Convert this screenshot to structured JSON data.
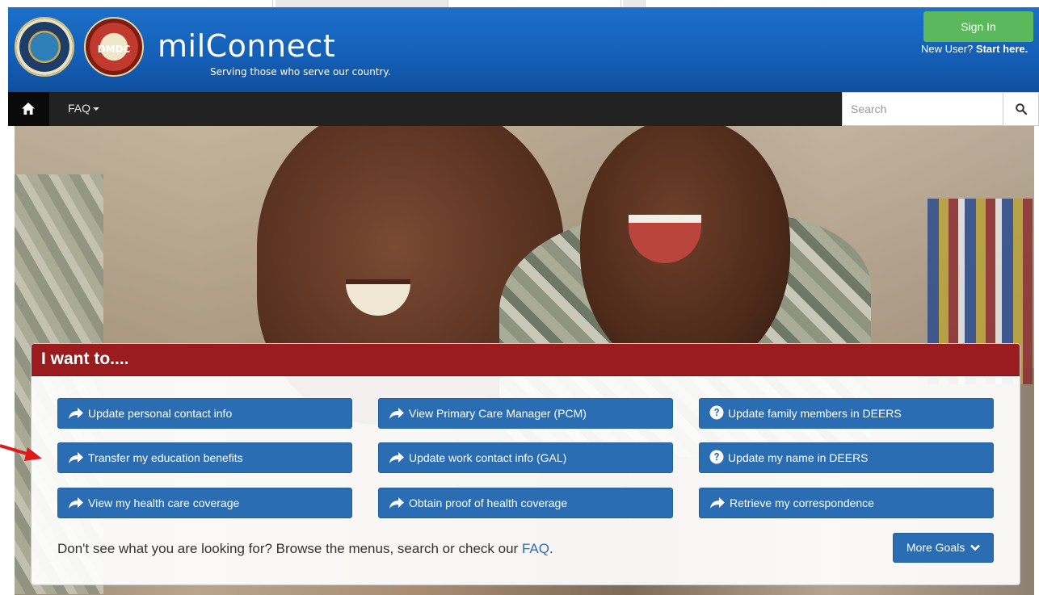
{
  "header": {
    "brand": "milConnect",
    "tagline": "Serving those who serve our country.",
    "dmdc_label": "DMDC",
    "sign_in": "Sign In",
    "new_user_prefix": "New User? ",
    "new_user_link": "Start here."
  },
  "nav": {
    "faq_label": "FAQ",
    "search_placeholder": "Search"
  },
  "goals": {
    "title": "I want to....",
    "items": [
      {
        "label": "Update personal contact info",
        "icon": "arrow-icon"
      },
      {
        "label": "View Primary Care Manager (PCM)",
        "icon": "arrow-icon"
      },
      {
        "label": "Update family members in DEERS",
        "icon": "question-circle-icon"
      },
      {
        "label": "Transfer my education benefits",
        "icon": "arrow-icon"
      },
      {
        "label": "Update work contact info (GAL)",
        "icon": "arrow-icon"
      },
      {
        "label": "Update my name in DEERS",
        "icon": "question-circle-icon"
      },
      {
        "label": "View my health care coverage",
        "icon": "arrow-icon"
      },
      {
        "label": "Obtain proof of health coverage",
        "icon": "arrow-icon"
      },
      {
        "label": "Retrieve my correspondence",
        "icon": "arrow-icon"
      }
    ],
    "browse_text": "Don't see what you are looking for? Browse the menus, search or check our ",
    "browse_link": "FAQ",
    "browse_end": ".",
    "more_goals": "More Goals"
  },
  "colors": {
    "header_blue": "#1560b8",
    "nav_dark": "#222222",
    "sign_in_green": "#5cb85c",
    "panel_red": "#9b1c1f",
    "button_blue": "#2a6db2",
    "annotation_red": "#e0191b"
  }
}
